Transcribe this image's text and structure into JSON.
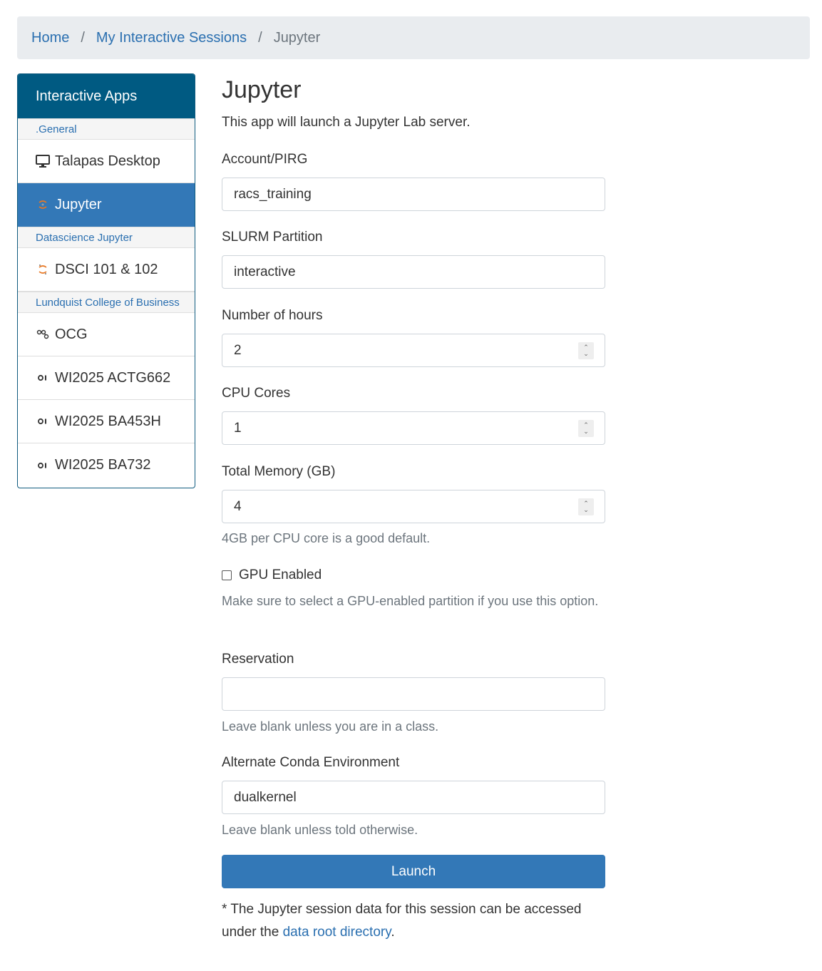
{
  "breadcrumb": {
    "items": [
      "Home",
      "My Interactive Sessions"
    ],
    "separator": "/",
    "current": "Jupyter"
  },
  "sidebar": {
    "header": "Interactive Apps",
    "groups": [
      {
        "label": ".General",
        "items": [
          {
            "label": "Talapas Desktop",
            "icon": "desktop-icon"
          },
          {
            "label": "Jupyter",
            "icon": "jupyter-icon",
            "active": true
          }
        ]
      },
      {
        "label": "Datascience Jupyter",
        "items": [
          {
            "label": "DSCI 101 & 102",
            "icon": "jupyter-logo-icon"
          }
        ]
      },
      {
        "label": "Lundquist College of Business",
        "items": [
          {
            "label": "OCG",
            "icon": "ocg-icon"
          },
          {
            "label": "WI2025 ACTG662",
            "icon": "oi-icon"
          },
          {
            "label": "WI2025 BA453H",
            "icon": "oi-icon"
          },
          {
            "label": "WI2025 BA732",
            "icon": "oi-icon"
          }
        ]
      }
    ]
  },
  "form": {
    "title": "Jupyter",
    "description": "This app will launch a Jupyter Lab server.",
    "account": {
      "label": "Account/PIRG",
      "value": "racs_training"
    },
    "partition": {
      "label": "SLURM Partition",
      "value": "interactive"
    },
    "hours": {
      "label": "Number of hours",
      "value": "2"
    },
    "cores": {
      "label": "CPU Cores",
      "value": "1"
    },
    "memory": {
      "label": "Total Memory (GB)",
      "value": "4",
      "help": "4GB per CPU core is a good default."
    },
    "gpu": {
      "label": "GPU Enabled",
      "checked": false,
      "help": "Make sure to select a GPU-enabled partition if you use this option."
    },
    "reservation": {
      "label": "Reservation",
      "value": "",
      "help": "Leave blank unless you are in a class."
    },
    "conda": {
      "label": "Alternate Conda Environment",
      "value": "dualkernel",
      "help": "Leave blank unless told otherwise."
    },
    "launch_label": "Launch",
    "footnote_prefix": "* The Jupyter session data for this session can be accessed under the ",
    "footnote_link": "data root directory",
    "footnote_suffix": "."
  },
  "colors": {
    "link": "#2a6fb0",
    "primary": "#3378b7",
    "sidebar_header": "#005a82"
  }
}
